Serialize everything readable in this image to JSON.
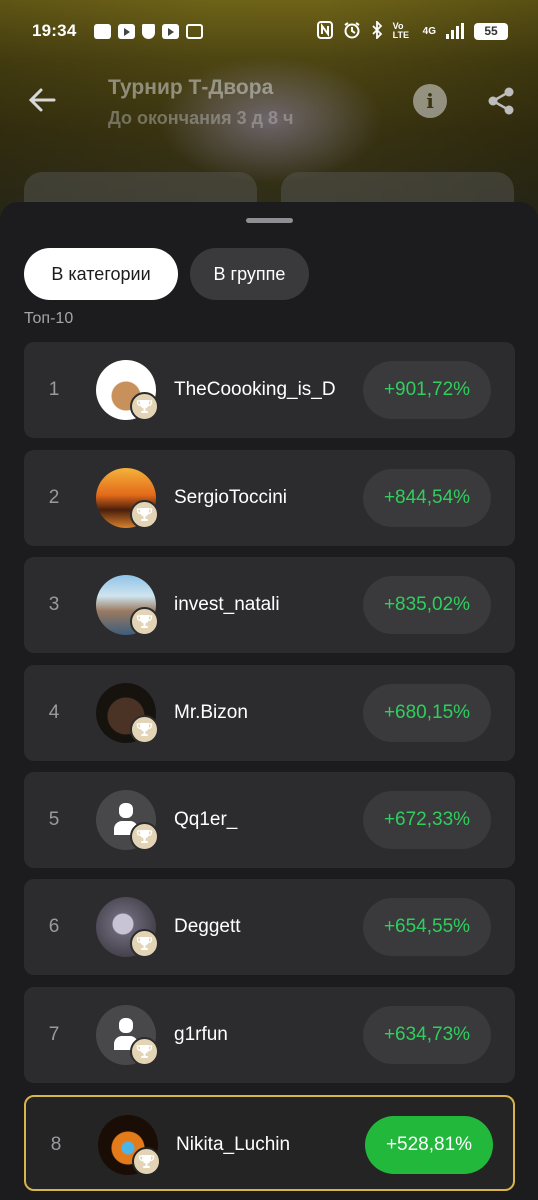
{
  "status_bar": {
    "time": "19:34",
    "network": "4G",
    "volte": "Vo LTE",
    "battery": "55"
  },
  "header": {
    "title": "Турнир Т-Двора",
    "subtitle": "До окончания 3 д 8 ч"
  },
  "tabs": [
    {
      "label": "В категории",
      "active": true
    },
    {
      "label": "В группе",
      "active": false
    }
  ],
  "list_title": "Топ-10",
  "leaderboard": [
    {
      "rank": "1",
      "name": "TheCoooking_is_D",
      "change": "+901,72%",
      "avatar": "dog-avatar"
    },
    {
      "rank": "2",
      "name": "SergioToccini",
      "change": "+844,54%",
      "avatar": "sunset-avatar"
    },
    {
      "rank": "3",
      "name": "invest_natali",
      "change": "+835,02%",
      "avatar": "beach-avatar"
    },
    {
      "rank": "4",
      "name": "Mr.Bizon",
      "change": "+680,15%",
      "avatar": "bison-avatar"
    },
    {
      "rank": "5",
      "name": "Qq1er_",
      "change": "+672,33%",
      "avatar": "default-user-avatar"
    },
    {
      "rank": "6",
      "name": "Deggett",
      "change": "+654,55%",
      "avatar": "bird-avatar"
    },
    {
      "rank": "7",
      "name": "g1rfun",
      "change": "+634,73%",
      "avatar": "default-user-avatar"
    },
    {
      "rank": "8",
      "name": "Nikita_Luchin",
      "change": "+528,81%",
      "avatar": "eye-pyramid-avatar",
      "current_user": true
    }
  ],
  "colors": {
    "positive": "#2fcf5d",
    "current_user_pill": "#22b83c",
    "current_user_border": "#d8b54a",
    "card": "#2c2c2e",
    "sheet": "#1c1c1e"
  }
}
